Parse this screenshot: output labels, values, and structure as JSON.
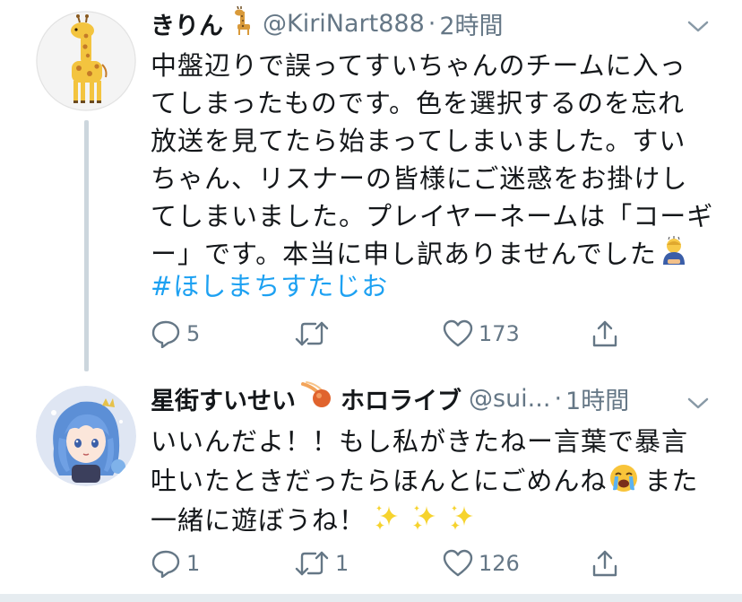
{
  "tweets": [
    {
      "name": "きりん",
      "name_emoji": "giraffe-emoji",
      "handle": "@KiriNart888",
      "separator": "·",
      "time": "2時間",
      "avatar": "giraffe-avatar",
      "lines": [
        "中盤辺りで誤ってすいちゃんのチームに入っ",
        "てしまったものです。色を選択するのを忘れ",
        "放送を見てたら始まってしまいました。すい",
        "ちゃん、リスナーの皆様にご迷惑をお掛けし",
        "てしまいました。プレイヤーネームは「コーギ",
        "ー」です。本当に申し訳ありませんでした"
      ],
      "trailing_emoji": "bowing-person-emoji",
      "hashtag": "#ほしまちすたじお",
      "actions": {
        "reply_count": "5",
        "retweet_count": "",
        "like_count": "173",
        "share_label": ""
      }
    },
    {
      "name": "星街すいせい",
      "name_emoji": "comet-emoji",
      "name_suffix": "ホロライブ",
      "handle": "@sui...",
      "separator": "·",
      "time": "1時間",
      "avatar": "suisei-avatar",
      "lines": [
        "いいんだよ！！もし私がきたねー言葉で暴言",
        "吐いたときだったらほんとにごめんね",
        "一緒に遊ぼうね！"
      ],
      "line2_tail": "また",
      "emojis": [
        "crying-face-emoji",
        "sparkles-emoji",
        "sparkles-emoji",
        "sparkles-emoji"
      ],
      "actions": {
        "reply_count": "1",
        "retweet_count": "1",
        "like_count": "126",
        "share_label": ""
      }
    }
  ],
  "colors": {
    "text": "#14171a",
    "secondary": "#657786",
    "link": "#1da1f2",
    "thread_line": "#ccd6dd",
    "divider": "#e6ecf0"
  }
}
